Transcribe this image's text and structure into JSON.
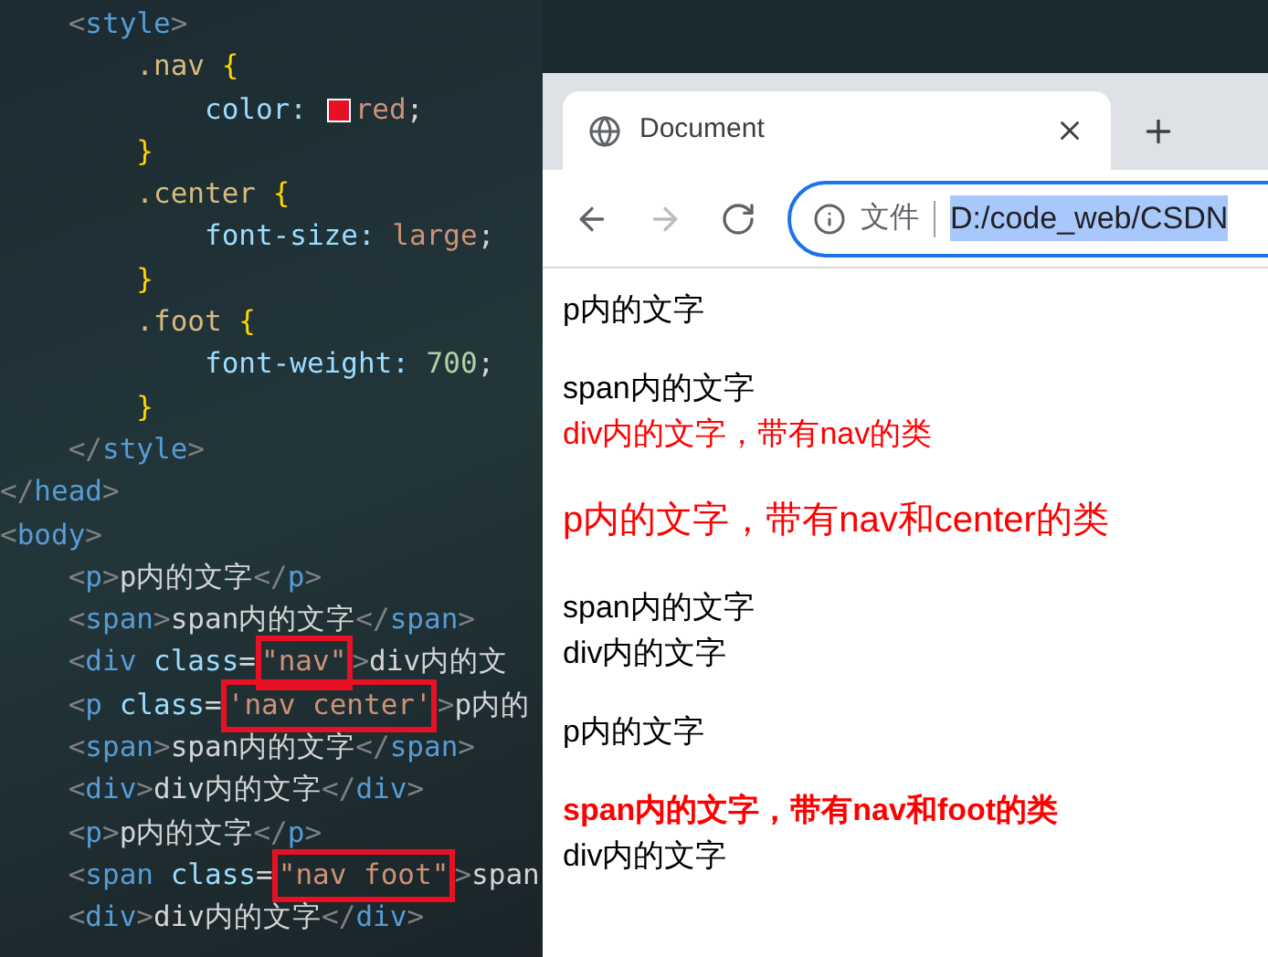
{
  "editor": {
    "lines": [
      {
        "tokens": [
          {
            "kind": "punct",
            "text": "    <"
          },
          {
            "kind": "tag",
            "text": "style"
          },
          {
            "kind": "punct",
            "text": ">"
          }
        ]
      },
      {
        "tokens": [
          {
            "kind": "selector",
            "text": "        .nav "
          },
          {
            "kind": "brace",
            "text": "{"
          }
        ]
      },
      {
        "tokens": [
          {
            "kind": "property",
            "text": "            color: "
          },
          {
            "kind": "swatch",
            "color": "#e81123"
          },
          {
            "kind": "value",
            "text": "red"
          },
          {
            "kind": "plain",
            "text": ";"
          }
        ]
      },
      {
        "tokens": [
          {
            "kind": "brace",
            "text": "        }"
          }
        ]
      },
      {
        "tokens": [
          {
            "kind": "selector",
            "text": "        .center "
          },
          {
            "kind": "brace",
            "text": "{"
          }
        ]
      },
      {
        "tokens": [
          {
            "kind": "property",
            "text": "            font-size: "
          },
          {
            "kind": "value",
            "text": "large"
          },
          {
            "kind": "plain",
            "text": ";"
          }
        ]
      },
      {
        "tokens": [
          {
            "kind": "brace",
            "text": "        }"
          }
        ]
      },
      {
        "tokens": [
          {
            "kind": "selector",
            "text": "        .foot "
          },
          {
            "kind": "brace",
            "text": "{"
          }
        ]
      },
      {
        "tokens": [
          {
            "kind": "property",
            "text": "            font-weight: "
          },
          {
            "kind": "number",
            "text": "700"
          },
          {
            "kind": "plain",
            "text": ";"
          }
        ]
      },
      {
        "tokens": [
          {
            "kind": "brace",
            "text": "        }"
          }
        ]
      },
      {
        "tokens": [
          {
            "kind": "punct",
            "text": "    </"
          },
          {
            "kind": "tag",
            "text": "style"
          },
          {
            "kind": "punct",
            "text": ">"
          }
        ]
      },
      {
        "tokens": [
          {
            "kind": "punct",
            "text": "</"
          },
          {
            "kind": "tag",
            "text": "head"
          },
          {
            "kind": "punct",
            "text": ">"
          }
        ]
      },
      {
        "tokens": [
          {
            "kind": "punct",
            "text": "<"
          },
          {
            "kind": "tag",
            "text": "body"
          },
          {
            "kind": "punct",
            "text": ">"
          }
        ]
      },
      {
        "tokens": [
          {
            "kind": "punct",
            "text": "    <"
          },
          {
            "kind": "tag",
            "text": "p"
          },
          {
            "kind": "punct",
            "text": ">"
          },
          {
            "kind": "plain",
            "text": "p内的文字"
          },
          {
            "kind": "punct",
            "text": "</"
          },
          {
            "kind": "tag",
            "text": "p"
          },
          {
            "kind": "punct",
            "text": ">"
          }
        ]
      },
      {
        "tokens": [
          {
            "kind": "punct",
            "text": "    <"
          },
          {
            "kind": "tag",
            "text": "span"
          },
          {
            "kind": "punct",
            "text": ">"
          },
          {
            "kind": "plain",
            "text": "span内的文字"
          },
          {
            "kind": "punct",
            "text": "</"
          },
          {
            "kind": "tag",
            "text": "span"
          },
          {
            "kind": "punct",
            "text": ">"
          }
        ]
      },
      {
        "tokens": [
          {
            "kind": "punct",
            "text": "    <"
          },
          {
            "kind": "tag",
            "text": "div "
          },
          {
            "kind": "attr",
            "text": "class"
          },
          {
            "kind": "plain",
            "text": "="
          },
          {
            "kind": "string",
            "text": "\"nav\"",
            "boxed": true
          },
          {
            "kind": "punct",
            "text": ">"
          },
          {
            "kind": "plain",
            "text": "div内的文"
          }
        ]
      },
      {
        "tokens": [
          {
            "kind": "punct",
            "text": "    <"
          },
          {
            "kind": "tag",
            "text": "p "
          },
          {
            "kind": "attr",
            "text": "class"
          },
          {
            "kind": "plain",
            "text": "="
          },
          {
            "kind": "string",
            "text": "'nav center'",
            "boxed": true
          },
          {
            "kind": "punct",
            "text": ">"
          },
          {
            "kind": "plain",
            "text": "p内的"
          }
        ]
      },
      {
        "tokens": [
          {
            "kind": "punct",
            "text": "    <"
          },
          {
            "kind": "tag",
            "text": "span"
          },
          {
            "kind": "punct",
            "text": ">"
          },
          {
            "kind": "plain",
            "text": "span内的文字"
          },
          {
            "kind": "punct",
            "text": "</"
          },
          {
            "kind": "tag",
            "text": "span"
          },
          {
            "kind": "punct",
            "text": ">"
          }
        ]
      },
      {
        "tokens": [
          {
            "kind": "punct",
            "text": "    <"
          },
          {
            "kind": "tag",
            "text": "div"
          },
          {
            "kind": "punct",
            "text": ">"
          },
          {
            "kind": "plain",
            "text": "div内的文字"
          },
          {
            "kind": "punct",
            "text": "</"
          },
          {
            "kind": "tag",
            "text": "div"
          },
          {
            "kind": "punct",
            "text": ">"
          }
        ]
      },
      {
        "tokens": [
          {
            "kind": "punct",
            "text": "    <"
          },
          {
            "kind": "tag",
            "text": "p"
          },
          {
            "kind": "punct",
            "text": ">"
          },
          {
            "kind": "plain",
            "text": "p内的文字"
          },
          {
            "kind": "punct",
            "text": "</"
          },
          {
            "kind": "tag",
            "text": "p"
          },
          {
            "kind": "punct",
            "text": ">"
          }
        ]
      },
      {
        "tokens": [
          {
            "kind": "punct",
            "text": "    <"
          },
          {
            "kind": "tag",
            "text": "span "
          },
          {
            "kind": "attr",
            "text": "class"
          },
          {
            "kind": "plain",
            "text": "="
          },
          {
            "kind": "string",
            "text": "\"nav foot\"",
            "boxed": true
          },
          {
            "kind": "punct",
            "text": ">"
          },
          {
            "kind": "plain",
            "text": "span"
          }
        ]
      },
      {
        "tokens": [
          {
            "kind": "punct",
            "text": "    <"
          },
          {
            "kind": "tag",
            "text": "div"
          },
          {
            "kind": "punct",
            "text": ">"
          },
          {
            "kind": "plain",
            "text": "div内的文字"
          },
          {
            "kind": "punct",
            "text": "</"
          },
          {
            "kind": "tag",
            "text": "div"
          },
          {
            "kind": "punct",
            "text": ">"
          }
        ]
      }
    ]
  },
  "browser": {
    "tabs": [
      {
        "title": "Document",
        "selected": true
      }
    ],
    "nav_buttons": [
      {
        "kind": "back",
        "disabled": false
      },
      {
        "kind": "forward",
        "disabled": true
      },
      {
        "kind": "reload",
        "disabled": false
      }
    ],
    "address": {
      "scheme": "文件",
      "url": "D:/code_web/CSDN"
    },
    "content": [
      {
        "lines": [
          {
            "text": "p内的文字",
            "red": false,
            "large": false,
            "bold": false
          }
        ]
      },
      {
        "lines": [
          {
            "text": "span内的文字",
            "red": false,
            "large": false,
            "bold": false
          },
          {
            "text": "div内的文字，带有nav的类",
            "red": true,
            "large": false,
            "bold": false
          }
        ]
      },
      {
        "lines": [
          {
            "text": "p内的文字，带有nav和center的类",
            "red": true,
            "large": true,
            "bold": false
          }
        ]
      },
      {
        "lines": [
          {
            "text": "span内的文字",
            "red": false,
            "large": false,
            "bold": false
          },
          {
            "text": "div内的文字",
            "red": false,
            "large": false,
            "bold": false
          }
        ]
      },
      {
        "lines": [
          {
            "text": "p内的文字",
            "red": false,
            "large": false,
            "bold": false
          }
        ]
      },
      {
        "lines": [
          {
            "text": "span内的文字，带有nav和foot的类",
            "red": true,
            "large": false,
            "bold": true
          },
          {
            "text": "div内的文字",
            "red": false,
            "large": false,
            "bold": false
          }
        ]
      }
    ]
  }
}
